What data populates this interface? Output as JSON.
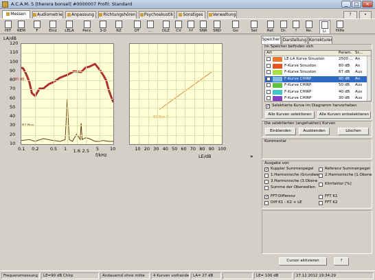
{
  "window": {
    "title": "A.C.A.M. 5 [therera bonsel] #0000007  Profil: Standard",
    "min": "_",
    "max": "□",
    "close": "×"
  },
  "tabs": [
    {
      "label": "Messen",
      "active": true
    },
    {
      "label": "Audiometrie"
    },
    {
      "label": "Anpassung"
    },
    {
      "label": "Richtungshören"
    },
    {
      "label": "Psychoakustik"
    },
    {
      "label": "Sonstiges"
    },
    {
      "label": "Verwaltung"
    }
  ],
  "tab_extra": {
    "help": "?",
    "dot": "•"
  },
  "toolbar": [
    {
      "label": "HIT",
      "icon": "hit-icon"
    },
    {
      "label": "REM",
      "icon": "rem-icon"
    },
    {
      "label": "F",
      "icon": "f-icon"
    },
    {
      "label": "Einz",
      "icon": "einz-icon"
    },
    {
      "label": "LELA",
      "icon": "lela-icon"
    },
    {
      "label": "Perz.",
      "icon": "perz-icon"
    },
    {
      "label": "3-D",
      "icon": "3d-icon"
    },
    {
      "label": "RZ",
      "icon": "rz-icon"
    },
    {
      "label": "DT",
      "icon": "dt-icon"
    },
    {
      "label": "...",
      "icon": "more-icon"
    },
    {
      "label": "DLZ",
      "icon": "dlz-icon"
    },
    {
      "label": "CV",
      "icon": "cv-icon"
    },
    {
      "label": "f-f",
      "icon": "ff-icon"
    },
    {
      "label": "SNR",
      "icon": "snr-icon"
    },
    {
      "label": "SND",
      "icon": "snd-icon"
    },
    {
      "label": "Go",
      "icon": "go-icon"
    },
    {
      "label": "Set",
      "icon": "settings-icon"
    },
    {
      "label": "Ref.",
      "icon": "ref-icon"
    },
    {
      "label": "Dr.",
      "icon": "print-icon"
    },
    {
      "label": "?",
      "icon": "help-icon"
    },
    {
      "label": "Re.",
      "icon": "re-icon"
    },
    {
      "label": "Li.",
      "icon": "li-icon"
    },
    {
      "label": "Hilfe",
      "icon": "hilfe-icon"
    }
  ],
  "chart_data": [
    {
      "type": "line",
      "xlabel": "f/kHz",
      "ylabel": "LA/dB",
      "xscale": "log",
      "xlim": [
        0.1,
        10
      ],
      "ylim": [
        10,
        120
      ],
      "xticks": [
        "0.1",
        "0.2",
        "0.5",
        "1",
        "1.6",
        "2.5",
        "5",
        "10"
      ],
      "yticks": [
        "120",
        "110",
        "100",
        "90",
        "80",
        "70",
        "60",
        "50",
        "40",
        "30",
        "20",
        "10"
      ],
      "annotations": [
        "80 dB",
        "82 Bon"
      ],
      "series": [
        {
          "color": "#b03030",
          "x": [
            0.1,
            0.11,
            0.13,
            0.15,
            0.17,
            0.2,
            0.25,
            0.3,
            0.4,
            0.5,
            0.7,
            1,
            1.4,
            2,
            2.5,
            3,
            4,
            5,
            6,
            7,
            8,
            9,
            10
          ],
          "y": [
            94,
            93,
            86,
            78,
            66,
            63,
            71,
            71,
            76,
            78,
            83,
            86,
            90,
            89,
            94,
            95,
            98,
            92,
            86,
            80,
            69,
            62,
            56
          ]
        },
        {
          "color": "#6b3a10",
          "x": [
            0.1,
            0.15,
            0.2,
            0.3,
            0.5,
            0.7,
            0.9,
            1,
            1.1,
            1.3,
            1.6,
            1.9,
            2,
            2.1,
            2.5,
            3,
            4,
            5,
            6,
            8,
            10
          ],
          "y": [
            14,
            15,
            13,
            16,
            14,
            13,
            15,
            60,
            15,
            13,
            21,
            15,
            33,
            15,
            17,
            16,
            13,
            13,
            14,
            13,
            13
          ]
        }
      ]
    },
    {
      "type": "line",
      "xlabel": "LE/dB",
      "ylabel": "",
      "xlim": [
        0,
        100
      ],
      "ylim": [
        10,
        120
      ],
      "xticks": [
        "10",
        "20",
        "30",
        "40",
        "50",
        "60",
        "70",
        "80",
        "90",
        "100"
      ],
      "annotations": [
        "82 Bon K"
      ],
      "series": [
        {
          "color": "#e08838",
          "x": [
            32,
            90
          ],
          "y": [
            48,
            90
          ]
        }
      ]
    }
  ],
  "expand": "»",
  "right": {
    "tabs": [
      "Speicher",
      "Darstellung",
      "Korrekturen"
    ],
    "memory_header": "Im Speicher befinden sich",
    "col_headers": [
      "Art",
      "Param.",
      "Sc..."
    ],
    "curves": [
      {
        "name": "LE-LA Kurve Sinuston",
        "param": "2500 ...",
        "sc": "An",
        "color": "#e87830",
        "checked": false
      },
      {
        "name": "F-Kurve Sinuston",
        "param": "80 dB",
        "sc": "An",
        "color": "#e85020",
        "checked": false
      },
      {
        "name": "F-Kurve Sinuston",
        "param": "67 dB",
        "sc": "Aus",
        "color": "#a8e040",
        "checked": false
      },
      {
        "name": "F-Kurve CHIRP",
        "param": "90 dB",
        "sc": "An",
        "color": "#7fc0e0",
        "checked": false,
        "selected": true
      },
      {
        "name": "F-Kurve CHIRP",
        "param": "50 dB",
        "sc": "Aus",
        "color": "#60c040",
        "checked": false
      },
      {
        "name": "F-Kurve CHIRP",
        "param": "40 dB",
        "sc": "Aus",
        "color": "#40c8c8",
        "checked": false
      },
      {
        "name": "F-Kurve CHIRP",
        "param": "30 dB",
        "sc": "Aus",
        "color": "#8040c8",
        "checked": false
      }
    ],
    "highlight_label": "Selektierte Kurve im Diagramm hervorheben",
    "select_all": "Alle Kurven selektieren",
    "deselect_all": "Alle Kurven entselektieren",
    "selected_group": "Die selektierten (angehakten) Kurven",
    "btn_show": "Einblenden",
    "btn_hide": "Ausblenden",
    "btn_delete": "Löschen",
    "comment_label": "Kommentar",
    "output_label": "Ausgabe von",
    "output_left": [
      {
        "label": "Kuppler Summenpegel",
        "checked": true
      },
      {
        "label": "1.Harmonische (Grundwe",
        "checked": false
      },
      {
        "label": "3.Harmonische (3.Oberw",
        "checked": false
      },
      {
        "label": "Summe der Oberwellen",
        "checked": false
      },
      {
        "label": "FFT-Differenz",
        "checked": true
      },
      {
        "label": "Diff K1 - K2 + LE",
        "checked": false
      }
    ],
    "output_right": [
      {
        "label": "Referenz Summenpegel",
        "checked": false
      },
      {
        "label": "2.Harmonische (1.Oberw",
        "checked": false
      },
      {
        "label": "Klirrfaktor [%]",
        "checked": false
      },
      {
        "label": "FFT K1",
        "checked": false
      },
      {
        "label": "FFT K2",
        "checked": false
      }
    ],
    "cursor_btn": "Cursor aktivieren",
    "help_btn": "?"
  },
  "status": [
    "Frequenzmessung",
    "LE=90 dB Chirp",
    "Andauernd ohne mitte",
    "4 Kurven vorhanden",
    "LA= 27 dB",
    "",
    "LE= 100 dB",
    "27.12.2012 19:34:29"
  ]
}
